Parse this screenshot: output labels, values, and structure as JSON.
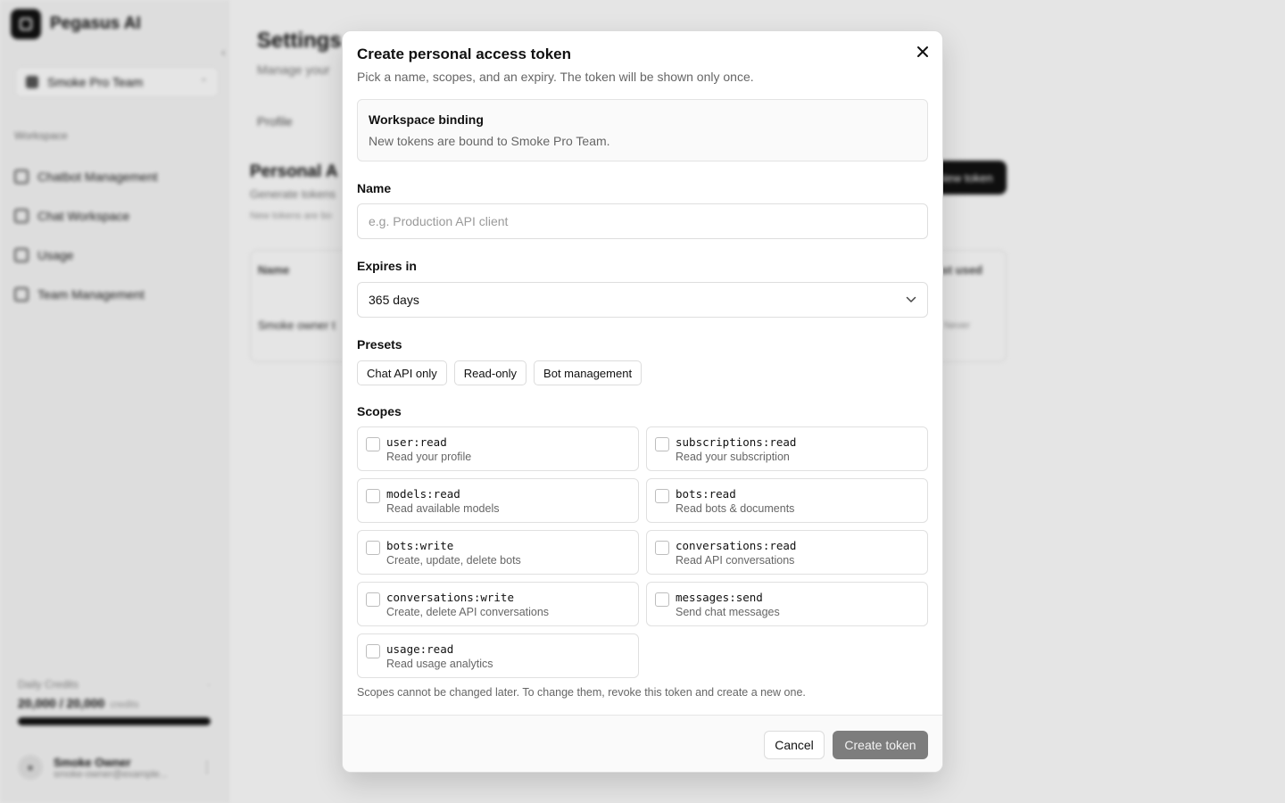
{
  "app": {
    "brand_name": "Pegasus AI",
    "team": "Smoke Pro Team",
    "nav_title": "Workspace",
    "nav_items": [
      "Chatbot Management",
      "Chat Workspace",
      "Usage",
      "Team Management"
    ],
    "credits_label": "Daily Credits",
    "credits_value": "20,000 / 20,000",
    "credits_unit": "credits",
    "credits_remaining_fraction": 1.0,
    "user_name": "Smoke Owner",
    "user_email": "smoke-owner@example...",
    "page_title": "Settings",
    "page_subtitle": "Manage your",
    "tabs": [
      "Profile"
    ],
    "section_title": "Personal A",
    "section_subtitle": "Generate tokens",
    "section_note": "New tokens are bo",
    "new_token_button": "New token",
    "table_header_name": "Name",
    "table_header_last_used": "Last used",
    "table_row_name": "Smoke owner t",
    "table_row_last_used": "Never"
  },
  "modal": {
    "title": "Create personal access token",
    "description": "Pick a name, scopes, and an expiry. The token will be shown only once.",
    "close_icon": "close-icon",
    "binding_title": "Workspace binding",
    "binding_text": "New tokens are bound to Smoke Pro Team.",
    "name_label": "Name",
    "name_value": "",
    "name_placeholder": "e.g. Production API client",
    "expires_label": "Expires in",
    "expires_value": "365 days",
    "presets_label": "Presets",
    "presets": [
      "Chat API only",
      "Read-only",
      "Bot management"
    ],
    "scopes_label": "Scopes",
    "scopes": [
      {
        "name": "user:read",
        "desc": "Read your profile",
        "checked": false
      },
      {
        "name": "subscriptions:read",
        "desc": "Read your subscription",
        "checked": false
      },
      {
        "name": "models:read",
        "desc": "Read available models",
        "checked": false
      },
      {
        "name": "bots:read",
        "desc": "Read bots & documents",
        "checked": false
      },
      {
        "name": "bots:write",
        "desc": "Create, update, delete bots",
        "checked": false
      },
      {
        "name": "conversations:read",
        "desc": "Read API conversations",
        "checked": false
      },
      {
        "name": "conversations:write",
        "desc": "Create, delete API conversations",
        "checked": false
      },
      {
        "name": "messages:send",
        "desc": "Send chat messages",
        "checked": false
      },
      {
        "name": "usage:read",
        "desc": "Read usage analytics",
        "checked": false
      }
    ],
    "scopes_note": "Scopes cannot be changed later. To change them, revoke this token and create a new one.",
    "cancel_label": "Cancel",
    "create_label": "Create token"
  },
  "colors": {
    "primary_disabled": "#7d7d7d",
    "overlay": "rgba(0,0,0,0.10)",
    "border": "#e0e0e0"
  }
}
